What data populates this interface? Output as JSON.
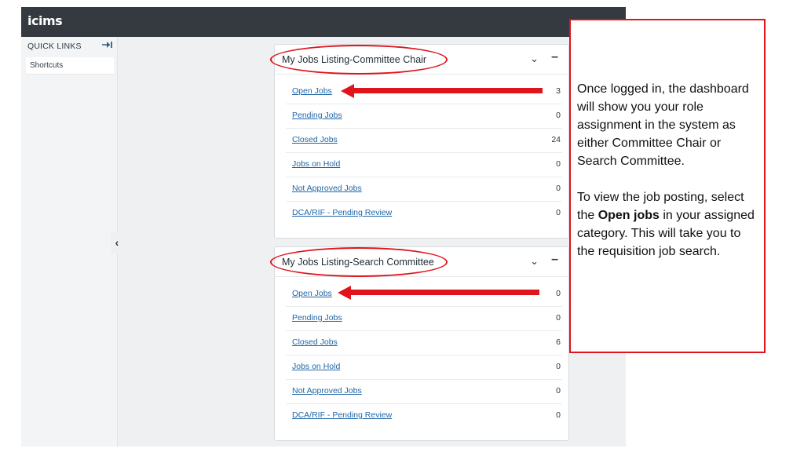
{
  "app": {
    "logo": "icims"
  },
  "sidebar": {
    "quick_links_label": "QUICK LINKS",
    "pin_icon": "pin-icon",
    "shortcuts_label": "Shortcuts",
    "collapse_icon": "chevron-left-icon"
  },
  "cards": [
    {
      "title": "My Jobs Listing-Committee Chair",
      "rows": [
        {
          "label": "Open Jobs",
          "count": "3"
        },
        {
          "label": "Pending Jobs",
          "count": "0"
        },
        {
          "label": "Closed Jobs",
          "count": "24"
        },
        {
          "label": "Jobs on Hold",
          "count": "0"
        },
        {
          "label": "Not Approved Jobs",
          "count": "0"
        },
        {
          "label": "DCA/RIF - Pending Review",
          "count": "0"
        }
      ]
    },
    {
      "title": "My Jobs Listing-Search Committee",
      "rows": [
        {
          "label": "Open Jobs",
          "count": "0"
        },
        {
          "label": "Pending Jobs",
          "count": "0"
        },
        {
          "label": "Closed Jobs",
          "count": "6"
        },
        {
          "label": "Jobs on Hold",
          "count": "0"
        },
        {
          "label": "Not Approved Jobs",
          "count": "0"
        },
        {
          "label": "DCA/RIF - Pending Review",
          "count": "0"
        }
      ]
    }
  ],
  "callout": {
    "para1": "Once logged in, the dashboard will show you your role assignment in the system as either Committee Chair or Search Committee.",
    "para2_before": "To view the job posting, select the ",
    "para2_bold": "Open jobs",
    "para2_after": " in your assigned category. This will take you to the requisition job search."
  },
  "colors": {
    "annotation": "#e0141b",
    "link": "#1f66a6",
    "topbar": "#343a40"
  }
}
